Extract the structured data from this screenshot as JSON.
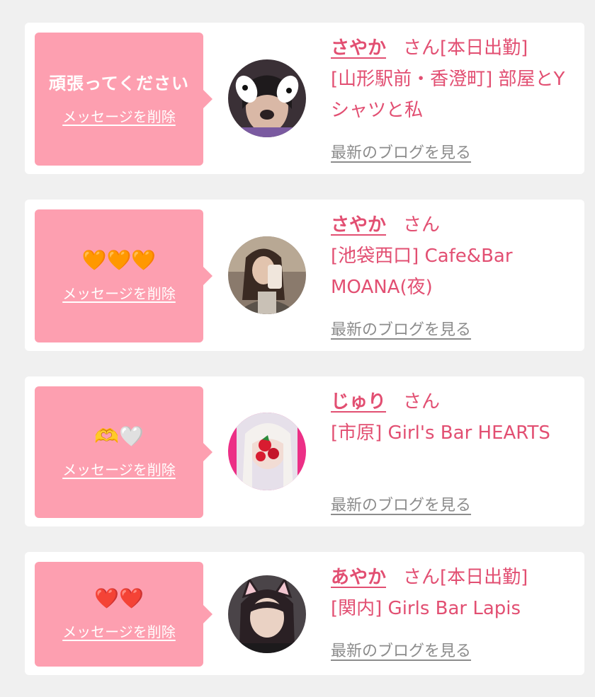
{
  "cards": [
    {
      "message": "頑張ってください",
      "delete_label": "メッセージを削除",
      "avatar_icon": "profile-photo",
      "name": "さやか",
      "honorific": "さん",
      "status": "[本日出勤]",
      "shop": "[山形駅前・香澄町] 部屋とYシャツと私",
      "blog_link": "最新のブログを見る"
    },
    {
      "message": "🧡🧡🧡",
      "delete_label": "メッセージを削除",
      "avatar_icon": "profile-photo",
      "name": "さやか",
      "honorific": "さん",
      "status": "",
      "shop": "[池袋西口] Cafe&Bar MOANA(夜)",
      "blog_link": "最新のブログを見る"
    },
    {
      "message": "🫶🤍",
      "delete_label": "メッセージを削除",
      "avatar_icon": "profile-photo",
      "name": "じゅり",
      "honorific": "さん",
      "status": "",
      "shop": "[市原] Girl's Bar HEARTS",
      "blog_link": "最新のブログを見る"
    },
    {
      "message": "❤️❤️",
      "delete_label": "メッセージを削除",
      "avatar_icon": "profile-photo",
      "name": "あやか",
      "honorific": "さん",
      "status": "[本日出勤]",
      "shop": "[関内] Girls Bar Lapis",
      "blog_link": "最新のブログを見る"
    }
  ],
  "colors": {
    "page_bg": "#f0f0f0",
    "bubble_bg": "#fd9fb0",
    "accent_text": "#e24f72",
    "link_gray": "#8c8c8c"
  }
}
